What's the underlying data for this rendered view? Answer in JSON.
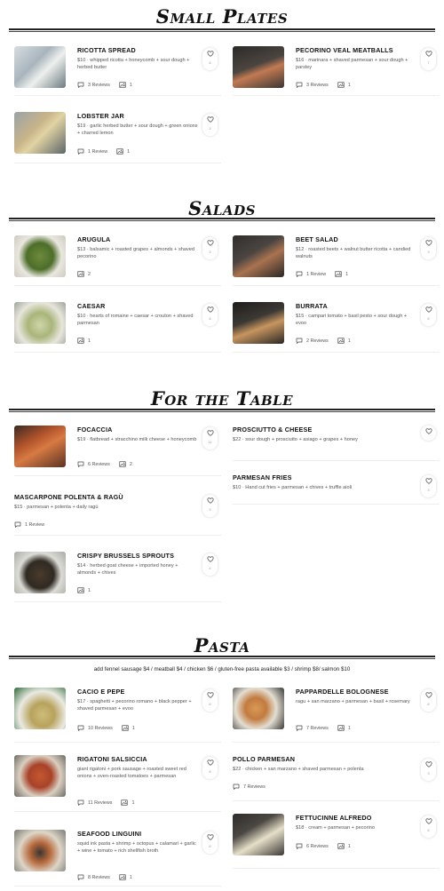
{
  "sections": [
    {
      "title": "Small Plates",
      "items": [
        {
          "name": "RICOTTA SPREAD",
          "desc": "$10 · whipped ricotta + honeycomb + sour dough + herbed butter",
          "reviews": "3 Reviews",
          "photos": "1",
          "likes": "8"
        },
        {
          "name": "PECORINO VEAL MEATBALLS",
          "desc": "$16 · marinara + shaved parmesan + sour dough + parsley",
          "reviews": "3 Reviews",
          "photos": "1",
          "likes": "7"
        },
        {
          "name": "LOBSTER JAR",
          "desc": "$19 · garlic herbed butter + sour dough + green onions + charred lemon",
          "reviews": "1 Review",
          "photos": "1",
          "likes": "3"
        }
      ]
    },
    {
      "title": "Salads",
      "items": [
        {
          "name": "ARUGULA",
          "desc": "$13 · balsamic + roasted grapes + almonds + shaved pecorino",
          "photos": "2",
          "likes": "3"
        },
        {
          "name": "BEET SALAD",
          "desc": "$12 · roasted beets + walnut butter ricotta + candied walnuts",
          "reviews": "1 Review",
          "photos": "1",
          "likes": "3"
        },
        {
          "name": "CAESAR",
          "desc": "$10 · hearts of romaine + caesar + crouton + shaved parmesan",
          "photos": "1",
          "likes": "8"
        },
        {
          "name": "BURRATA",
          "desc": "$15 · campari tomato + basil pesto + sour dough + evoo",
          "reviews": "2 Reviews",
          "photos": "1",
          "likes": "8"
        }
      ]
    },
    {
      "title": "For the Table",
      "items": [
        {
          "name": "FOCACCIA",
          "desc": "$19 · flatbread + stracchino milk cheese + honeycomb",
          "reviews": "6 Reviews",
          "photos": "2",
          "likes": "11"
        },
        {
          "name": "PROSCIUTTO & CHEESE",
          "desc": "$22 · sour dough + prosciutto + asiago + grapes + honey"
        },
        {
          "name": "PARMESAN FRIES",
          "desc": "$10 · Hand cut fries + parmesan + chives + truffle aioli",
          "likes": "3"
        },
        {
          "name": "MASCARPONE POLENTA & RAGÙ",
          "desc": "$15 · parmesan + polenta + daily ragù",
          "reviews": "1 Review",
          "likes": "3"
        },
        {
          "name": "CRISPY BRUSSELS SPROUTS",
          "desc": "$14 · herbed goat cheese + imported honey + almonds + chives",
          "photos": "1",
          "likes": "4"
        }
      ]
    },
    {
      "title": "Pasta",
      "note": "add fennel sausage $4 / meatball $4 / chicken $6 / gluten-free pasta available $3 / shrimp $8/ salmon $10",
      "items": [
        {
          "name": "CACIO E PEPE",
          "desc": "$17 · spaghetti + pecorino romano + black pepper + shaved parmesan + evoo",
          "reviews": "10 Reviews",
          "photos": "1",
          "likes": "8"
        },
        {
          "name": "PAPPARDELLE BOLOGNESE",
          "desc": "ragu + san marzano + parmesan + basil + rosemary",
          "reviews": "7 Reviews",
          "photos": "1",
          "likes": "8"
        },
        {
          "name": "RIGATONI SALSICCIA",
          "desc": "giant rigatoni + pork sausage + roasted sweet red onions + oven-roasted tomatoes + parmesan",
          "reviews": "11 Reviews",
          "photos": "1",
          "likes": "8"
        },
        {
          "name": "POLLO PARMESAN",
          "desc": "$22 · chicken + san marzano + shaved parmesan + polenta",
          "reviews": "7 Reviews",
          "likes": "3"
        },
        {
          "name": "SEAFOOD LINGUINI",
          "desc": "squid ink pasta + shrimp + octopus + calamari + garlic + wine + tomato + rich shellfish broth",
          "reviews": "8 Reviews",
          "photos": "1",
          "likes": "8"
        },
        {
          "name": "FETTUCINNE ALFREDO",
          "desc": "$18 · cream + parmesan + pecorino",
          "reviews": "6 Reviews",
          "photos": "1",
          "likes": "8"
        }
      ]
    }
  ]
}
